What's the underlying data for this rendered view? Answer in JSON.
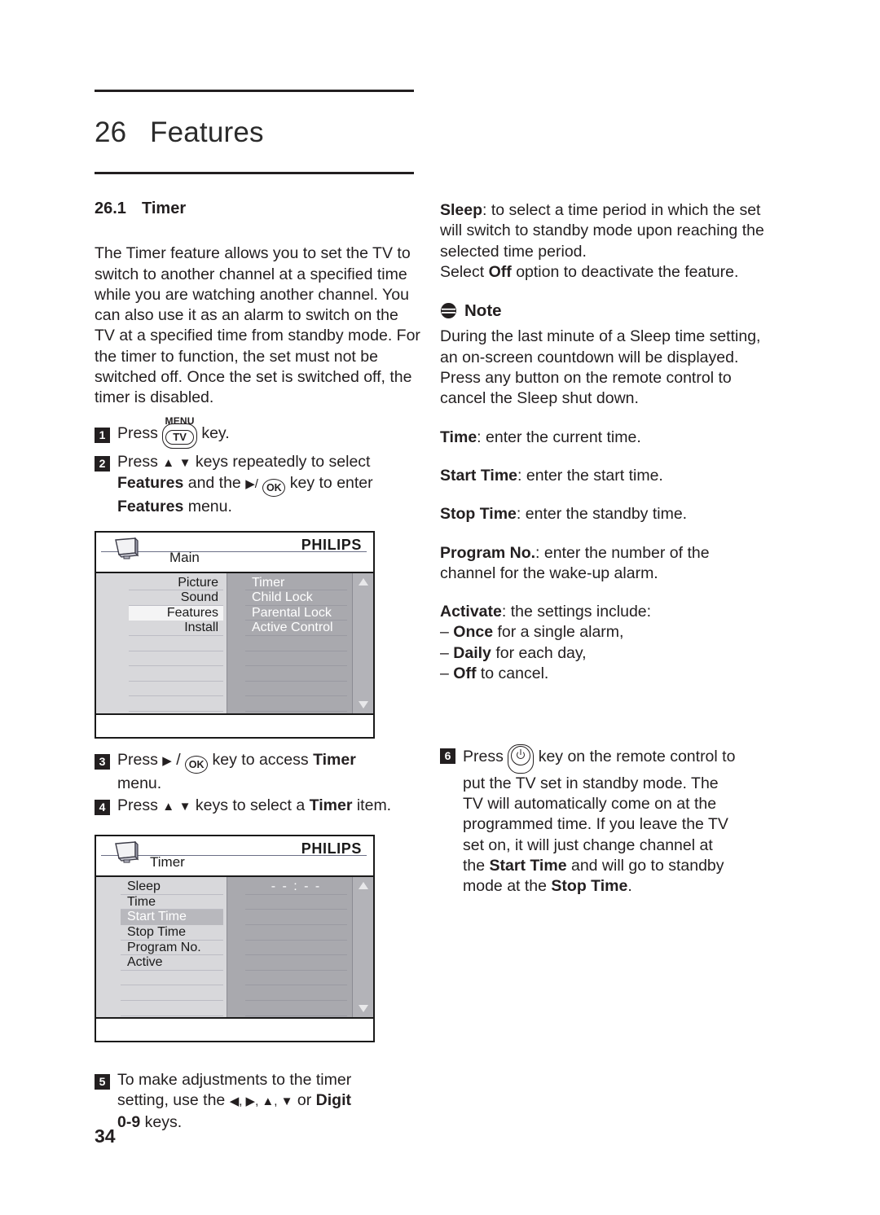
{
  "chapter": {
    "number": "26",
    "title": "Features"
  },
  "section": {
    "number": "26.1",
    "title": "Timer"
  },
  "left_column": {
    "intro": "The Timer feature allows you to set the TV to switch to another channel at a specified time while you are watching another channel. You can also use it as an alarm to switch on the TV at a specified time from standby mode. For the timer to function, the set must not be switched off. Once the set is switched off, the timer is disabled.",
    "step1": {
      "badge": "1",
      "press": "Press",
      "key_label": "MENU",
      "key_text": "TV",
      "tail": "key."
    },
    "step2": {
      "badge": "2",
      "line1_a": "Press",
      "line1_up": "▲",
      "line1_down": "▼",
      "line1_b": "keys repeatedly to select",
      "line2_bold": "Features",
      "line2_a": "and the",
      "line2_arrow": "▶/",
      "line2_ok": "OK",
      "line2_b": "key to enter",
      "line3_bold": "Features",
      "line3_tail": "menu."
    },
    "step3": {
      "badge": "3",
      "a": "Press",
      "arrow": "▶",
      "slash": "/",
      "ok": "OK",
      "b": "key to access",
      "bold": "Timer",
      "line2": "menu."
    },
    "step4": {
      "badge": "4",
      "a": "Press",
      "up": "▲",
      "down": "▼",
      "b": "keys to select a",
      "bold": "Timer",
      "tail": "item."
    },
    "step5": {
      "badge": "5",
      "line1": "To make adjustments to the timer",
      "line2_a": "setting, use the",
      "line2_arrows": "◀,  ▶, ▲, ▼",
      "line2_b": "or",
      "line2_bold": "Digit",
      "line3_bold": "0-9",
      "line3_tail": "keys."
    }
  },
  "osd_main": {
    "brand": "PHILIPS",
    "tv_icon": "tv-monitor-icon",
    "menu_name": "Main",
    "left_items": [
      {
        "label": "Picture",
        "selected": false
      },
      {
        "label": "Sound",
        "selected": false
      },
      {
        "label": "Features",
        "selected": true
      },
      {
        "label": "Install",
        "selected": false
      }
    ],
    "left_empty_rows": 5,
    "right_items": [
      "Timer",
      "Child Lock",
      "Parental Lock",
      "Active Control"
    ],
    "right_empty_rows": 5,
    "scroll_up": "▲",
    "scroll_down": "▼"
  },
  "osd_timer": {
    "brand": "PHILIPS",
    "tv_icon": "tv-monitor-icon",
    "menu_name": "Timer",
    "left_items": [
      {
        "label": "Sleep",
        "selected": false
      },
      {
        "label": "Time",
        "selected": false
      },
      {
        "label": "Start Time",
        "selected": true
      },
      {
        "label": "Stop Time",
        "selected": false
      },
      {
        "label": "Program No.",
        "selected": false
      },
      {
        "label": "Active",
        "selected": false
      }
    ],
    "left_empty_rows": 3,
    "right_value": "- - : - -",
    "right_empty_rows": 8,
    "scroll_up": "▲",
    "scroll_down": "▼"
  },
  "right_column": {
    "sleep": {
      "term": "Sleep",
      "rest": ": to select a time period in which the set will switch to standby mode upon reaching the selected time period.",
      "line2_a": "Select",
      "line2_bold": "Off",
      "line2_b": "option to deactivate the feature."
    },
    "note": {
      "icon": "note-icon",
      "heading": "Note",
      "body": "During the last minute of a Sleep time setting, an on-screen countdown will be displayed. Press any button on the remote control to cancel the Sleep shut down."
    },
    "time": {
      "term": "Time",
      "rest": ": enter the current time."
    },
    "start_time": {
      "term": "Start Time",
      "rest": ": enter the start time."
    },
    "stop_time": {
      "term": "Stop Time",
      "rest": ": enter the standby time."
    },
    "program_no": {
      "term": "Program No.",
      "rest": ": enter the number of the channel for the wake-up alarm."
    },
    "activate": {
      "term": "Activate",
      "rest": ": the settings include:",
      "options": [
        {
          "dash": "–",
          "bold": "Once",
          "rest": "for a single alarm,"
        },
        {
          "dash": "–",
          "bold": "Daily",
          "rest": "for each day,"
        },
        {
          "dash": "–",
          "bold": "Off",
          "rest": "to cancel."
        }
      ]
    },
    "step6": {
      "badge": "6",
      "press": "Press",
      "key": "power-standby-icon",
      "line1_tail": "key on the remote control to",
      "line2": "put the TV set in standby mode. The",
      "line3": "TV will automatically come on at the",
      "line4": "programmed time. If you leave the TV",
      "line5": "set on, it will just change channel at",
      "line6_a": "the",
      "line6_bold": "Start Time",
      "line6_b": "and will go to standby",
      "line7_a": "mode at the",
      "line7_bold": "Stop Time",
      "line7_tail": "."
    }
  },
  "folio": "34"
}
